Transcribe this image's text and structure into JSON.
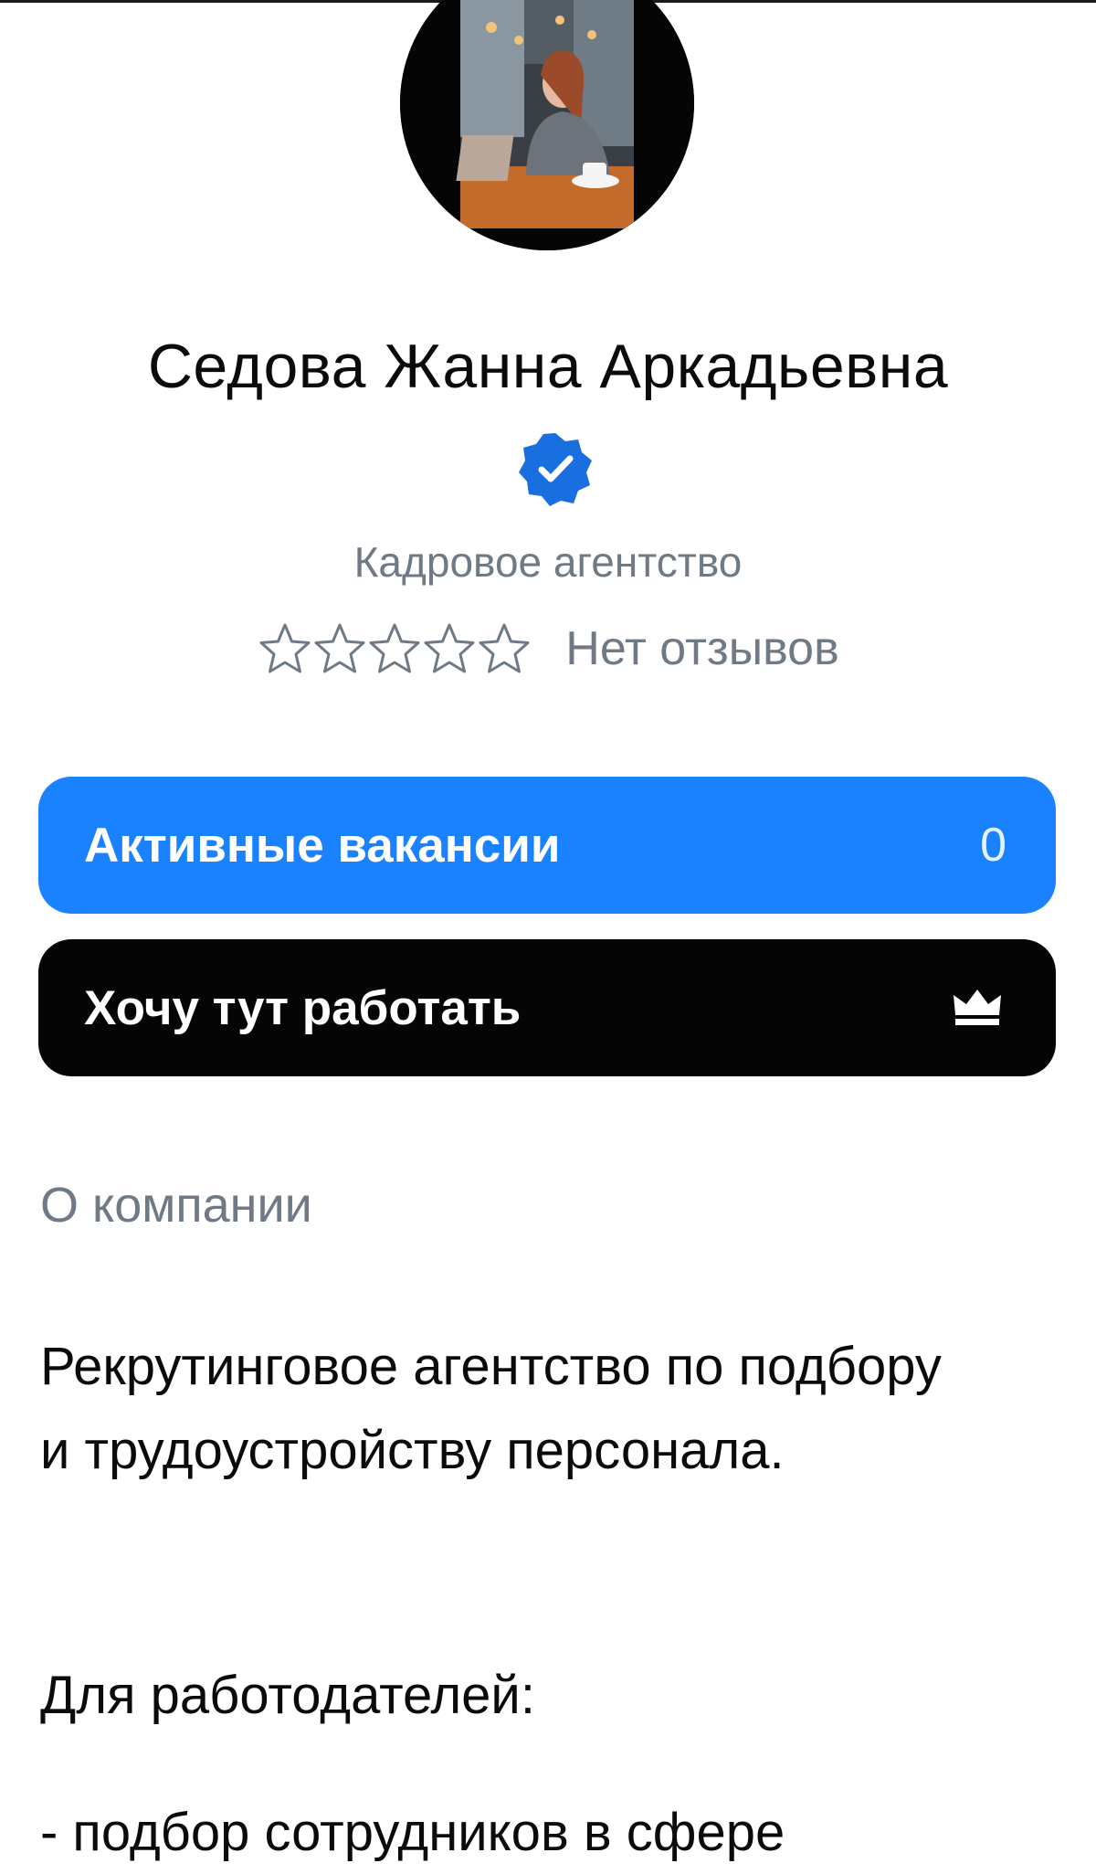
{
  "profile": {
    "name": "Седова Жанна Аркадьевна",
    "category": "Кадровое агентство",
    "reviews_text": "Нет отзывов",
    "rating_stars": 0,
    "verified": true
  },
  "buttons": {
    "vacancies_label": "Активные вакансии",
    "vacancies_count": "0",
    "want_label": "Хочу тут работать"
  },
  "about": {
    "title": "О компании",
    "description_lines": [
      "Рекрутинговое агентство по подбору",
      "и трудоустройству персонала."
    ],
    "employers_title": "Для работодателей:",
    "employers_items": [
      "- подбор сотрудников в сфере"
    ]
  },
  "colors": {
    "accent": "#1a82ff",
    "muted_text": "#6f7a86",
    "dark_button": "#050505"
  }
}
